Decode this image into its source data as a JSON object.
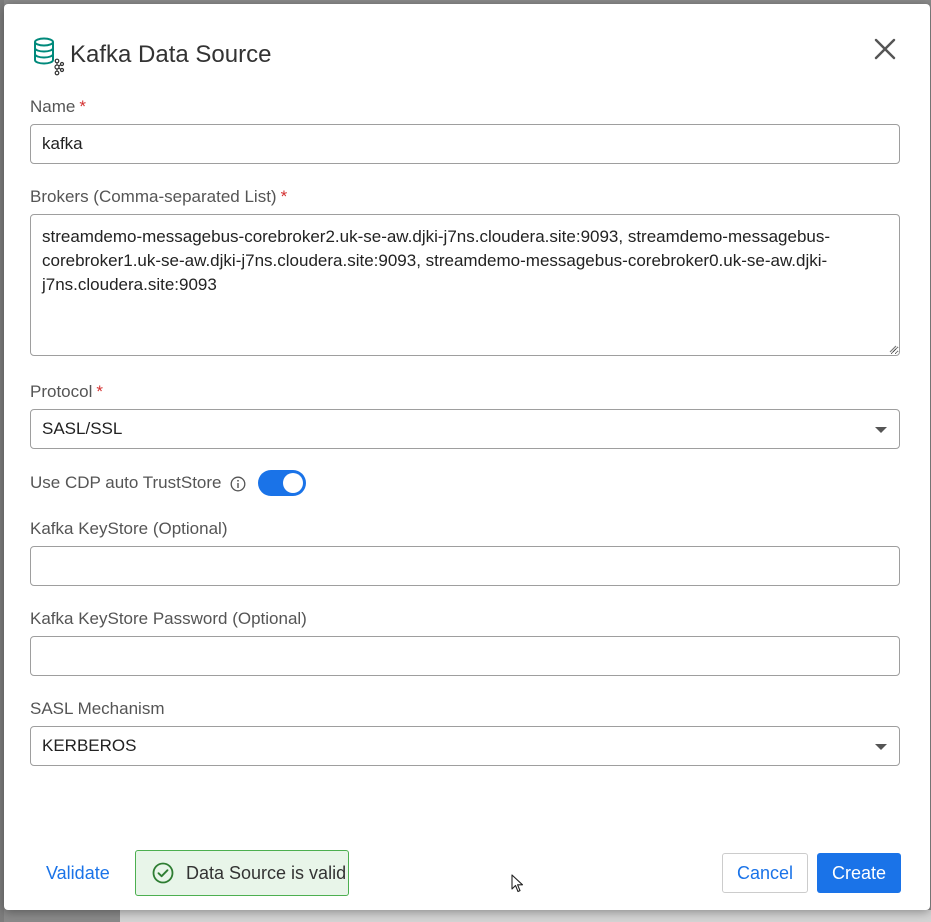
{
  "dialog": {
    "title": "Kafka Data Source",
    "icon": "database-kafka-icon",
    "accent_color": "#00897b"
  },
  "fields": {
    "name": {
      "label": "Name",
      "required_mark": "*",
      "value": "kafka"
    },
    "brokers": {
      "label": "Brokers (Comma-separated List)",
      "required_mark": "*",
      "value": "streamdemo-messagebus-corebroker2.uk-se-aw.djki-j7ns.cloudera.site:9093, streamdemo-messagebus-corebroker1.uk-se-aw.djki-j7ns.cloudera.site:9093, streamdemo-messagebus-corebroker0.uk-se-aw.djki-j7ns.cloudera.site:9093"
    },
    "protocol": {
      "label": "Protocol",
      "required_mark": "*",
      "selected": "SASL/SSL"
    },
    "truststore": {
      "label": "Use CDP auto TrustStore",
      "enabled": true
    },
    "keystore": {
      "label": "Kafka KeyStore (Optional)",
      "value": ""
    },
    "keystore_password": {
      "label": "Kafka KeyStore Password (Optional)",
      "value": ""
    },
    "sasl_mechanism": {
      "label": "SASL Mechanism",
      "selected": "KERBEROS"
    }
  },
  "footer": {
    "validate_label": "Validate",
    "status_text": "Data Source is valid",
    "cancel_label": "Cancel",
    "create_label": "Create"
  },
  "colors": {
    "primary": "#1a73e8",
    "success_border": "#4caf50",
    "success_bg": "#e8f5e9",
    "required": "#d32f2f"
  }
}
